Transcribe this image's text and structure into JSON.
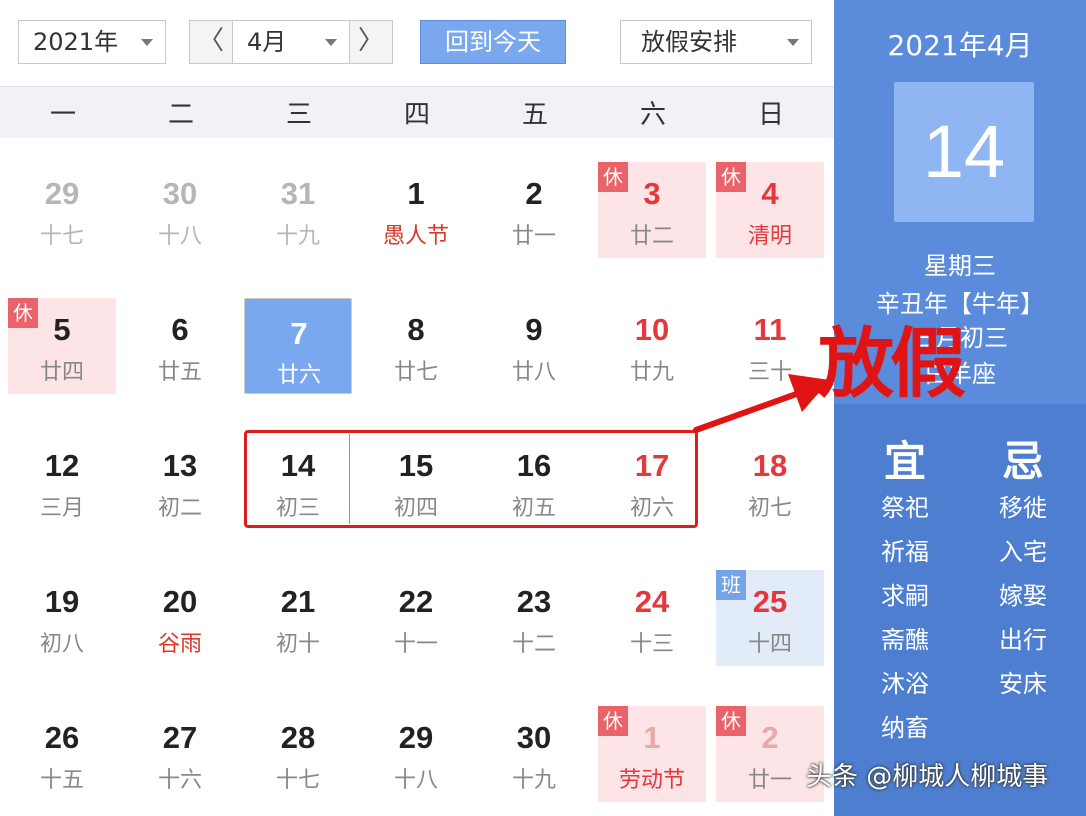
{
  "toolbar": {
    "year": "2021年",
    "month": "4月",
    "prev": "〈",
    "next": "〉",
    "today": "回到今天",
    "holiday": "放假安排"
  },
  "weekdays": [
    "一",
    "二",
    "三",
    "四",
    "五",
    "六",
    "日"
  ],
  "days": [
    {
      "num": "29",
      "lunar": "十七",
      "other": true
    },
    {
      "num": "30",
      "lunar": "十八",
      "other": true
    },
    {
      "num": "31",
      "lunar": "十九",
      "other": true
    },
    {
      "num": "1",
      "lunar": "愚人节",
      "festival": true
    },
    {
      "num": "2",
      "lunar": "廿一"
    },
    {
      "num": "3",
      "lunar": "廿二",
      "badge": "休",
      "bg": "hol",
      "red": true
    },
    {
      "num": "4",
      "lunar": "清明",
      "badge": "休",
      "bg": "hol",
      "red": true,
      "festival": true
    },
    {
      "num": "5",
      "lunar": "廿四",
      "badge": "休",
      "bg": "hol"
    },
    {
      "num": "6",
      "lunar": "廿五"
    },
    {
      "num": "7",
      "lunar": "廿六",
      "bg": "sel"
    },
    {
      "num": "8",
      "lunar": "廿七"
    },
    {
      "num": "9",
      "lunar": "廿八"
    },
    {
      "num": "10",
      "lunar": "廿九",
      "red": true
    },
    {
      "num": "11",
      "lunar": "三十",
      "red": true
    },
    {
      "num": "12",
      "lunar": "三月"
    },
    {
      "num": "13",
      "lunar": "初二"
    },
    {
      "num": "14",
      "lunar": "初三"
    },
    {
      "num": "15",
      "lunar": "初四"
    },
    {
      "num": "16",
      "lunar": "初五"
    },
    {
      "num": "17",
      "lunar": "初六",
      "red": true
    },
    {
      "num": "18",
      "lunar": "初七",
      "red": true
    },
    {
      "num": "19",
      "lunar": "初八"
    },
    {
      "num": "20",
      "lunar": "谷雨",
      "festival": true
    },
    {
      "num": "21",
      "lunar": "初十"
    },
    {
      "num": "22",
      "lunar": "十一"
    },
    {
      "num": "23",
      "lunar": "十二"
    },
    {
      "num": "24",
      "lunar": "十三",
      "red": true
    },
    {
      "num": "25",
      "lunar": "十四",
      "badge": "班",
      "bg": "work",
      "red": true
    },
    {
      "num": "26",
      "lunar": "十五"
    },
    {
      "num": "27",
      "lunar": "十六"
    },
    {
      "num": "28",
      "lunar": "十七"
    },
    {
      "num": "29",
      "lunar": "十八"
    },
    {
      "num": "30",
      "lunar": "十九"
    },
    {
      "num": "1",
      "lunar": "劳动节",
      "badge": "休",
      "bg": "hol",
      "faded": true,
      "festival": true,
      "red": true
    },
    {
      "num": "2",
      "lunar": "廿一",
      "badge": "休",
      "bg": "hol",
      "faded": true
    }
  ],
  "annotation": "放假",
  "panel": {
    "month": "2021年4月",
    "day": "14",
    "weekday": "星期三",
    "ganzhi": "辛丑年【牛年】",
    "lunar": "三月初三",
    "star": "白羊座",
    "yi_title": "宜",
    "ji_title": "忌",
    "yi": [
      "祭祀",
      "祈福",
      "求嗣",
      "斋醮",
      "沐浴",
      "纳畜"
    ],
    "ji": [
      "移徙",
      "入宅",
      "嫁娶",
      "出行",
      "安床"
    ]
  },
  "watermark": "头条 @柳城人柳城事",
  "colors": {
    "accent": "#7aa8ee",
    "panel": "#5b8cdc",
    "holiday_bg": "#fde4e6",
    "red": "#e01414"
  }
}
